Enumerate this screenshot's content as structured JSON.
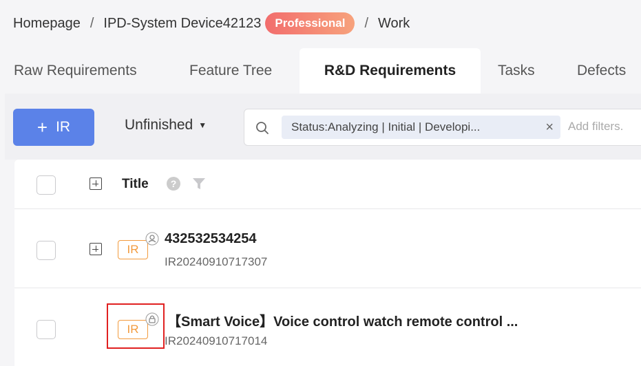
{
  "breadcrumb": {
    "home": "Homepage",
    "separator": "/",
    "project": "IPD-System Device42123",
    "badge": "Professional",
    "current": "Work"
  },
  "tabs": [
    {
      "label": "Raw Requirements",
      "active": false
    },
    {
      "label": "Feature Tree",
      "active": false
    },
    {
      "label": "R&D Requirements",
      "active": true
    },
    {
      "label": "Tasks",
      "active": false
    },
    {
      "label": "Defects",
      "active": false
    }
  ],
  "toolbar": {
    "add_button_icon": "+",
    "add_button_label": "IR",
    "filter_dropdown": "Unfinished",
    "search": {
      "icon": "search-icon",
      "chip_text": "Status:Analyzing | Initial | Developi...",
      "chip_close": "×",
      "placeholder": "Add filters."
    }
  },
  "table": {
    "header": {
      "title": "Title",
      "help": "?"
    },
    "rows": [
      {
        "type": "IR",
        "title": "432532534254",
        "id": "IR20240910717307",
        "expandable": true
      },
      {
        "type": "IR",
        "title": "【Smart Voice】Voice control watch remote control ...",
        "id": "IR20240910717014",
        "expandable": false
      }
    ]
  },
  "colors": {
    "accent": "#5b82e8",
    "tag_orange": "#f29a3c",
    "badge_start": "#f26d6d",
    "badge_end": "#f7a27c",
    "highlight_red": "#e02020"
  }
}
